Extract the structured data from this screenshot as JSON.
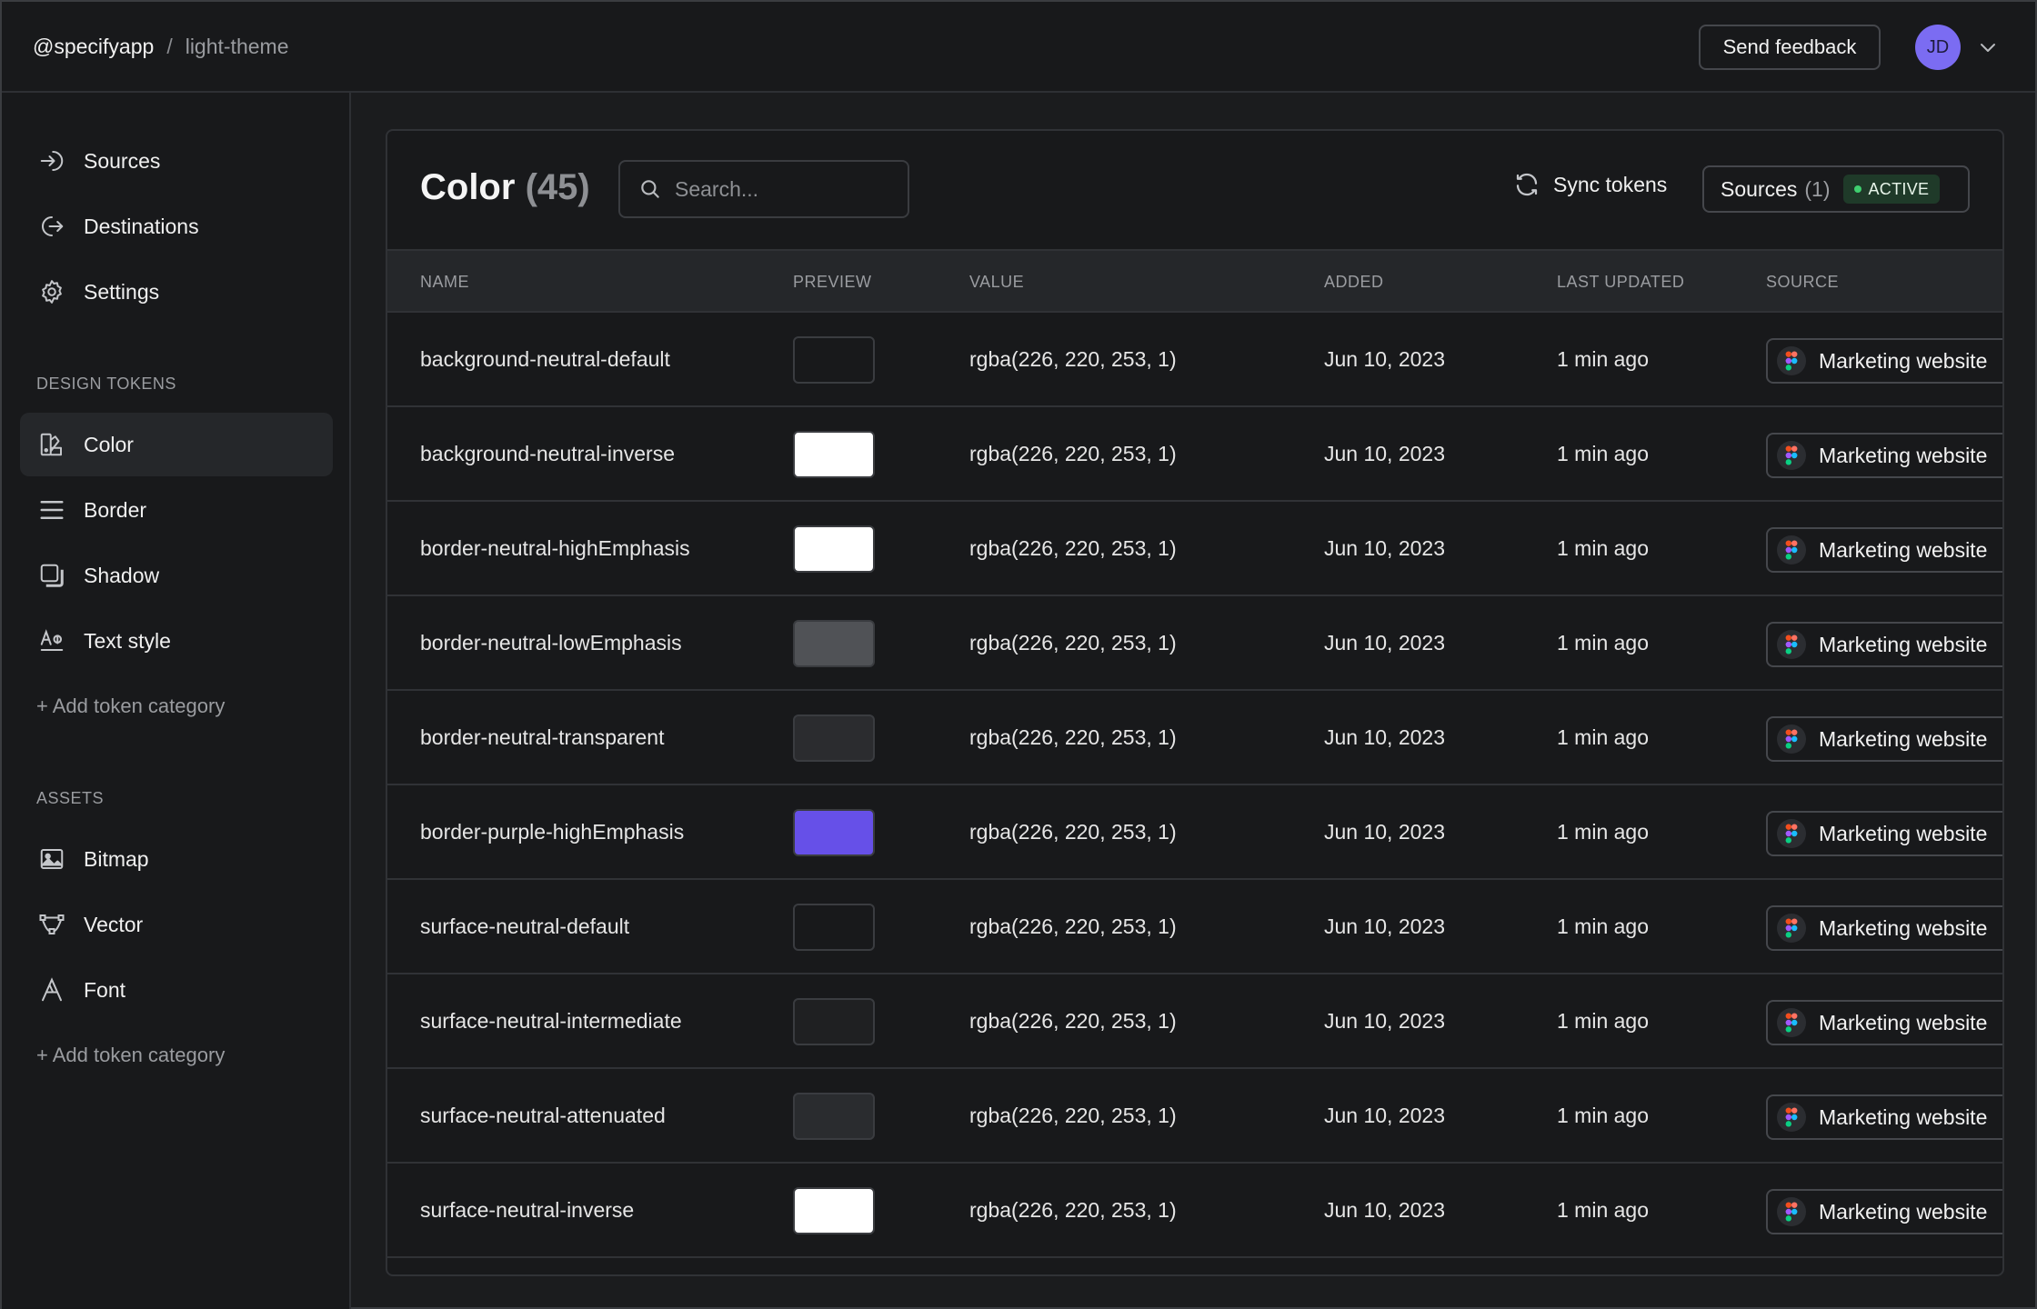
{
  "breadcrumb": {
    "org": "@specifyapp",
    "separator": "/",
    "project": "light-theme"
  },
  "header": {
    "feedback_label": "Send feedback",
    "avatar_initials": "JD"
  },
  "sidebar": {
    "nav": [
      {
        "label": "Sources",
        "icon": "arrow-in-icon"
      },
      {
        "label": "Destinations",
        "icon": "arrow-out-icon"
      },
      {
        "label": "Settings",
        "icon": "gear-icon"
      }
    ],
    "design_tokens_label": "DESIGN TOKENS",
    "design_tokens": [
      {
        "label": "Color",
        "icon": "color-icon",
        "active": true
      },
      {
        "label": "Border",
        "icon": "border-icon"
      },
      {
        "label": "Shadow",
        "icon": "shadow-icon"
      },
      {
        "label": "Text style",
        "icon": "text-style-icon"
      }
    ],
    "add_category_label": "+ Add token category",
    "assets_label": "ASSETS",
    "assets": [
      {
        "label": "Bitmap",
        "icon": "image-icon"
      },
      {
        "label": "Vector",
        "icon": "vector-icon"
      },
      {
        "label": "Font",
        "icon": "font-icon"
      }
    ],
    "add_category_label_2": "+ Add token category"
  },
  "main": {
    "title": "Color",
    "count": "(45)",
    "search_placeholder": "Search...",
    "sync_label": "Sync tokens",
    "sources_label": "Sources",
    "sources_count": "(1)",
    "active_badge": "ACTIVE",
    "columns": [
      "NAME",
      "PREVIEW",
      "VALUE",
      "ADDED",
      "LAST UPDATED",
      "SOURCE"
    ],
    "rows": [
      {
        "name": "background-neutral-default",
        "swatch": "#18191b",
        "value": "rgba(226, 220, 253, 1)",
        "added": "Jun 10, 2023",
        "updated": "1 min ago",
        "source": "Marketing website"
      },
      {
        "name": "background-neutral-inverse",
        "swatch": "#ffffff",
        "value": "rgba(226, 220, 253, 1)",
        "added": "Jun 10, 2023",
        "updated": "1 min ago",
        "source": "Marketing website"
      },
      {
        "name": "border-neutral-highEmphasis",
        "swatch": "#ffffff",
        "value": "rgba(226, 220, 253, 1)",
        "added": "Jun 10, 2023",
        "updated": "1 min ago",
        "source": "Marketing website"
      },
      {
        "name": "border-neutral-lowEmphasis",
        "swatch": "#505256",
        "value": "rgba(226, 220, 253, 1)",
        "added": "Jun 10, 2023",
        "updated": "1 min ago",
        "source": "Marketing website"
      },
      {
        "name": "border-neutral-transparent",
        "swatch": "#2b2c2f",
        "value": "rgba(226, 220, 253, 1)",
        "added": "Jun 10, 2023",
        "updated": "1 min ago",
        "source": "Marketing website"
      },
      {
        "name": "border-purple-highEmphasis",
        "swatch": "#6650e8",
        "value": "rgba(226, 220, 253, 1)",
        "added": "Jun 10, 2023",
        "updated": "1 min ago",
        "source": "Marketing website"
      },
      {
        "name": "surface-neutral-default",
        "swatch": "#18191b",
        "value": "rgba(226, 220, 253, 1)",
        "added": "Jun 10, 2023",
        "updated": "1 min ago",
        "source": "Marketing website"
      },
      {
        "name": "surface-neutral-intermediate",
        "swatch": "#1f2022",
        "value": "rgba(226, 220, 253, 1)",
        "added": "Jun 10, 2023",
        "updated": "1 min ago",
        "source": "Marketing website"
      },
      {
        "name": "surface-neutral-attenuated",
        "swatch": "#2a2c2f",
        "value": "rgba(226, 220, 253, 1)",
        "added": "Jun 10, 2023",
        "updated": "1 min ago",
        "source": "Marketing website"
      },
      {
        "name": "surface-neutral-inverse",
        "swatch": "#ffffff",
        "value": "rgba(226, 220, 253, 1)",
        "added": "Jun 10, 2023",
        "updated": "1 min ago",
        "source": "Marketing website"
      }
    ]
  }
}
